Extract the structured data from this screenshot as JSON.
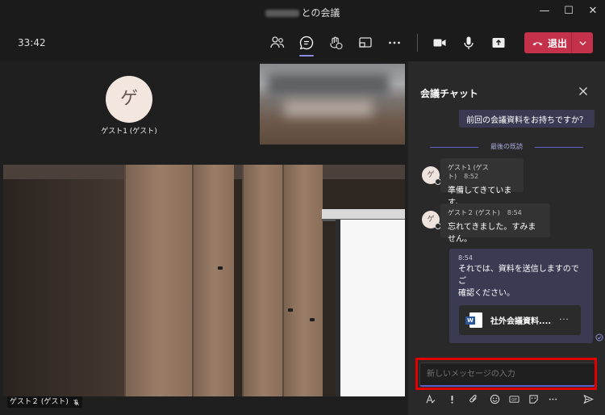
{
  "window": {
    "title_suffix": "との会議",
    "minimize": "—",
    "maximize": "☐",
    "close": "✕"
  },
  "toolbar": {
    "timer": "33:42",
    "leave_label": "退出",
    "icons": [
      "people-icon",
      "chat-icon",
      "reactions-icon",
      "share-screen-tray-icon",
      "more-icon",
      "camera-icon",
      "mic-icon",
      "share-icon"
    ]
  },
  "stage": {
    "participant_avatar_initial": "ゲ",
    "participant_name": "ゲスト1 (ゲスト)",
    "video_participant_name": "ゲスト２ (ゲスト)"
  },
  "chat": {
    "title": "会議チャット",
    "previous_message": "前回の会議資料をお持ちですか？",
    "last_read_label": "最後の既読",
    "messages": [
      {
        "avatar_initial": "ゲ",
        "sender": "ゲスト1 (ゲスト)",
        "time": "8:52",
        "text": "準備してきています。"
      },
      {
        "avatar_initial": "ゲ",
        "sender": "ゲスト２ (ゲスト)",
        "time": "8:54",
        "text": "忘れてきました。すみません。"
      }
    ],
    "own_message": {
      "time": "8:54",
      "line1": "それでは、資料を送信しますのでご",
      "line2": "確認ください。",
      "attachment_name": "社外会議資料....",
      "attachment_more": "···"
    },
    "compose_placeholder": "新しいメッセージの入力"
  },
  "colors": {
    "accent": "#5b5fc7",
    "leave_red": "#c4314b",
    "highlight_red": "#e00000"
  }
}
